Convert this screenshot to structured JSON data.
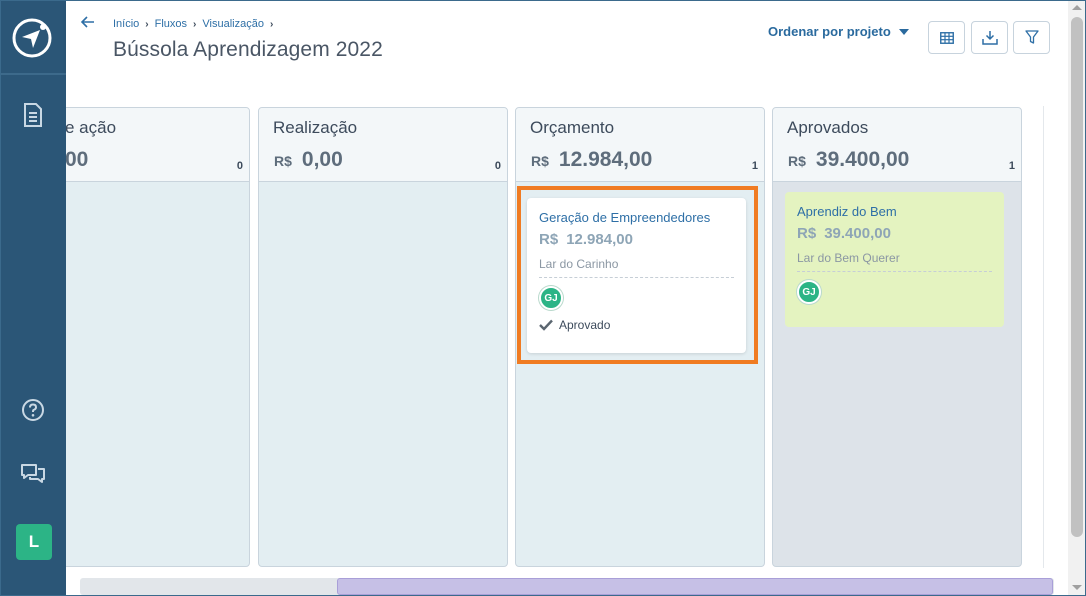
{
  "sidebar": {
    "avatar_letter": "L",
    "icons": [
      "compass-logo-icon",
      "document-icon",
      "help-icon",
      "chat-icon"
    ]
  },
  "header": {
    "breadcrumb": [
      "Início",
      "Fluxos",
      "Visualização"
    ],
    "title": "Bússola Aprendizagem 2022",
    "sort_label": "Ordenar por projeto",
    "tools": [
      "table-view-icon",
      "download-icon",
      "filter-icon"
    ]
  },
  "columns": [
    {
      "name": "e ação",
      "currency": "",
      "total": "00",
      "count": "0"
    },
    {
      "name": "Realização",
      "currency": "R$",
      "total": "0,00",
      "count": "0"
    },
    {
      "name": "Orçamento",
      "currency": "R$",
      "total": "12.984,00",
      "count": "1"
    },
    {
      "name": "Aprovados",
      "currency": "R$",
      "total": "39.400,00",
      "count": "1"
    }
  ],
  "cards": [
    {
      "column": "Orçamento",
      "name": "Geração de Empreendedores",
      "currency": "R$",
      "total": "12.984,00",
      "organization": "Lar do Carinho",
      "avatar": "GJ",
      "status": "Aprovado"
    },
    {
      "column": "Aprovados",
      "name": "Aprendiz do Bem",
      "currency": "R$",
      "total": "39.400,00",
      "organization": "Lar do Bem Querer",
      "avatar": "GJ"
    }
  ],
  "colors": {
    "sidebar": "#2b5677",
    "accent": "#2e6fa6",
    "highlight": "#f07b22",
    "avatar": "#2cb486",
    "approved_card": "#e4f3c0"
  }
}
